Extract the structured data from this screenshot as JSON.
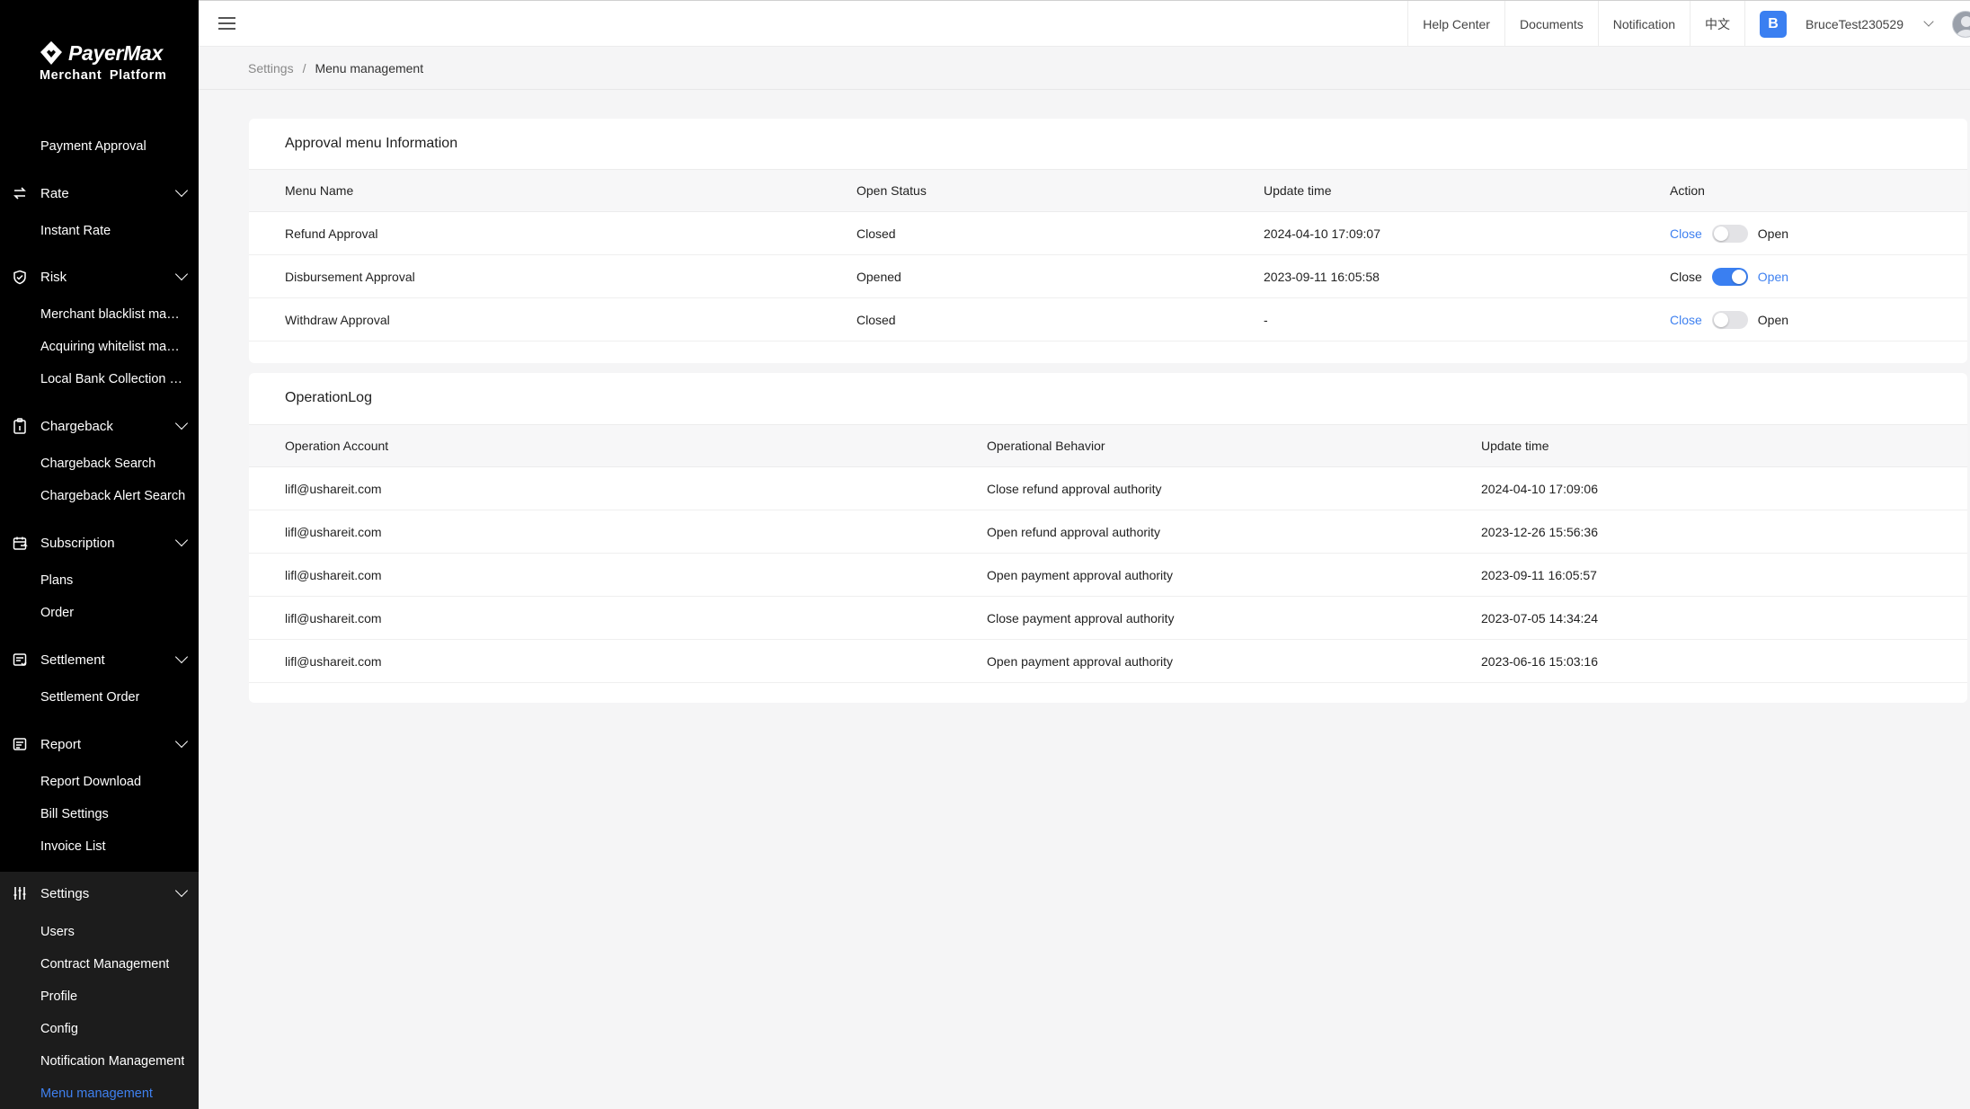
{
  "brand": {
    "name": "PayerMax",
    "subtitle": "Merchant  Platform"
  },
  "sidebar": {
    "items": [
      {
        "type": "sub",
        "label": "Payment Approval",
        "name": "sidebar-item-payment-approval"
      },
      {
        "type": "group",
        "label": "Rate",
        "icon": "exchange-icon",
        "name": "sidebar-group-rate"
      },
      {
        "type": "sub",
        "label": "Instant Rate",
        "name": "sidebar-item-instant-rate"
      },
      {
        "type": "group",
        "label": "Risk",
        "icon": "shield-check-icon",
        "name": "sidebar-group-risk"
      },
      {
        "type": "sub",
        "label": "Merchant blacklist management",
        "name": "sidebar-item-merchant-blacklist"
      },
      {
        "type": "sub",
        "label": "Acquiring whitelist management",
        "name": "sidebar-item-acquiring-whitelist"
      },
      {
        "type": "sub",
        "label": "Local Bank Collection List",
        "name": "sidebar-item-local-bank-collection"
      },
      {
        "type": "group",
        "label": "Chargeback",
        "icon": "clipboard-icon",
        "name": "sidebar-group-chargeback"
      },
      {
        "type": "sub",
        "label": "Chargeback Search",
        "name": "sidebar-item-chargeback-search"
      },
      {
        "type": "sub",
        "label": "Chargeback Alert Search",
        "name": "sidebar-item-chargeback-alert-search"
      },
      {
        "type": "group",
        "label": "Subscription",
        "icon": "calendar-repeat-icon",
        "name": "sidebar-group-subscription"
      },
      {
        "type": "sub",
        "label": "Plans",
        "name": "sidebar-item-plans"
      },
      {
        "type": "sub",
        "label": "Order",
        "name": "sidebar-item-order"
      },
      {
        "type": "group",
        "label": "Settlement",
        "icon": "ledger-icon",
        "name": "sidebar-group-settlement"
      },
      {
        "type": "sub",
        "label": "Settlement Order",
        "name": "sidebar-item-settlement-order"
      },
      {
        "type": "group",
        "label": "Report",
        "icon": "report-icon",
        "name": "sidebar-group-report"
      },
      {
        "type": "sub",
        "label": "Report Download",
        "name": "sidebar-item-report-download"
      },
      {
        "type": "sub",
        "label": "Bill Settings",
        "name": "sidebar-item-bill-settings"
      },
      {
        "type": "sub",
        "label": "Invoice List",
        "name": "sidebar-item-invoice-list"
      },
      {
        "type": "group",
        "label": "Settings",
        "icon": "sliders-icon",
        "name": "sidebar-group-settings"
      },
      {
        "type": "sub",
        "label": "Users",
        "name": "sidebar-item-users"
      },
      {
        "type": "sub",
        "label": "Contract Management",
        "name": "sidebar-item-contract-management"
      },
      {
        "type": "sub",
        "label": "Profile",
        "name": "sidebar-item-profile"
      },
      {
        "type": "sub",
        "label": "Config",
        "name": "sidebar-item-config"
      },
      {
        "type": "sub",
        "label": "Notification Management",
        "name": "sidebar-item-notification-management"
      },
      {
        "type": "sub",
        "label": "Menu management",
        "name": "sidebar-item-menu-management",
        "active": true
      }
    ]
  },
  "header": {
    "help_center": "Help Center",
    "documents": "Documents",
    "notification": "Notification",
    "language": "中文",
    "avatar_letter": "B",
    "username": "BruceTest230529"
  },
  "breadcrumb": {
    "parent": "Settings",
    "separator": "/",
    "current": "Menu management"
  },
  "approval": {
    "title": "Approval menu Information",
    "columns": [
      "Menu Name",
      "Open Status",
      "Update time",
      "Action"
    ],
    "rows": [
      {
        "menu": "Refund Approval",
        "status": "Closed",
        "updated": "2024-04-10 17:09:07",
        "close_label": "Close",
        "open_label": "Open",
        "is_open": false
      },
      {
        "menu": "Disbursement Approval",
        "status": "Opened",
        "updated": "2023-09-11 16:05:58",
        "close_label": "Close",
        "open_label": "Open",
        "is_open": true
      },
      {
        "menu": "Withdraw Approval",
        "status": "Closed",
        "updated": "-",
        "close_label": "Close",
        "open_label": "Open",
        "is_open": false
      }
    ]
  },
  "oplog": {
    "title": "OperationLog",
    "columns": [
      "Operation Account",
      "Operational Behavior",
      "Update time"
    ],
    "rows": [
      {
        "account": "lifl@ushareit.com",
        "behavior": "Close refund approval authority",
        "time": "2024-04-10 17:09:06"
      },
      {
        "account": "lifl@ushareit.com",
        "behavior": "Open refund approval authority",
        "time": "2023-12-26 15:56:36"
      },
      {
        "account": "lifl@ushareit.com",
        "behavior": "Open payment approval authority",
        "time": "2023-09-11 16:05:57"
      },
      {
        "account": "lifl@ushareit.com",
        "behavior": "Close payment approval authority",
        "time": "2023-07-05 14:34:24"
      },
      {
        "account": "lifl@ushareit.com",
        "behavior": "Open payment approval authority",
        "time": "2023-06-16 15:03:16"
      }
    ]
  },
  "colors": {
    "accent": "#3f81f0",
    "sidebar_bg": "#000000",
    "sidebar_active_bg": "#1c1c1c",
    "page_bg": "#f5f5f6"
  }
}
